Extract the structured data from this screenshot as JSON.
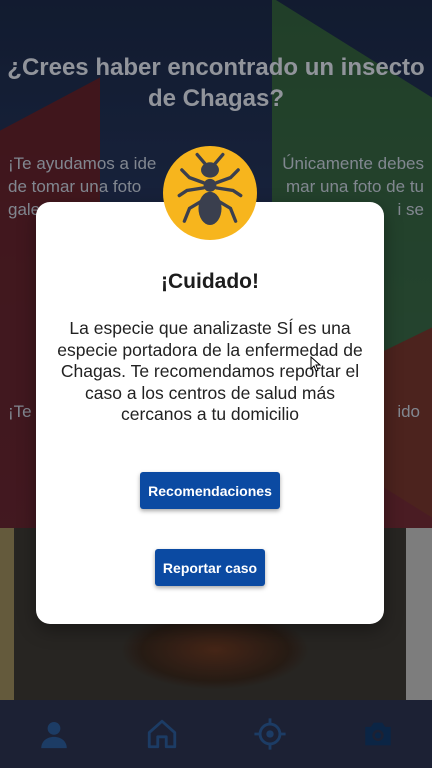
{
  "screen": {
    "title": "¿Crees haber encontrado un insecto de Chagas?",
    "intro_left": "¡Te ayudamos a ide",
    "intro_right": "Únicamente debes",
    "intro_line2_left": "de tomar una foto",
    "intro_line2_right": "mar una foto de tu",
    "intro_line3_left": "gale",
    "intro_line3_right": "i se",
    "hint_left": "¡Te",
    "hint_right": "ido"
  },
  "modal": {
    "title": "¡Cuidado!",
    "message": "La especie que analizaste SÍ es una especie portadora de la enfermedad de Chagas. Te recomendamos reportar el caso a los centros de salud más cercanos a tu domicilio",
    "recommendations_label": "Recomendaciones",
    "report_label": "Reportar caso",
    "badge_icon": "ant-icon",
    "badge_color": "#f7b51d",
    "button_color": "#0b4aa2"
  },
  "nav": {
    "items": [
      {
        "icon": "user-icon"
      },
      {
        "icon": "home-icon"
      },
      {
        "icon": "location-target-icon"
      },
      {
        "icon": "camera-icon",
        "active": true
      }
    ],
    "inactive_color": "#2c5d9b",
    "active_color": "#123a6a"
  }
}
